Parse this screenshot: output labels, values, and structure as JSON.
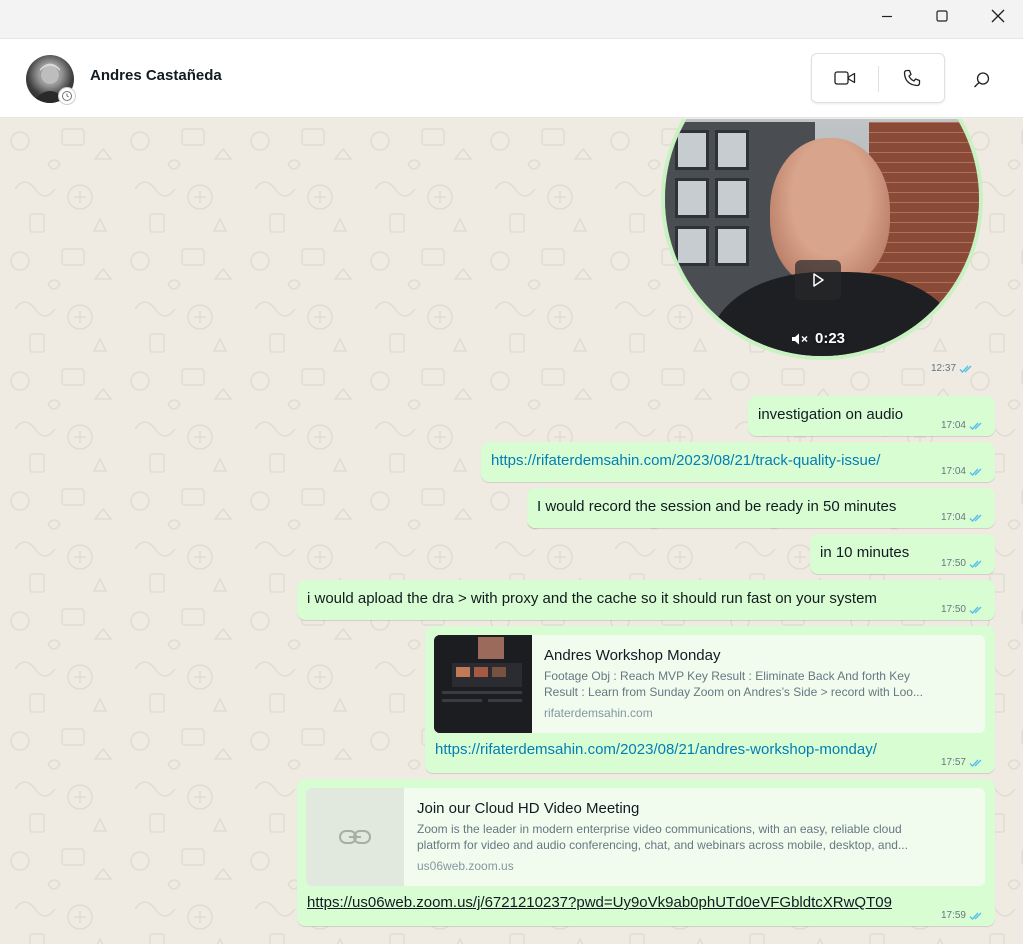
{
  "window": {
    "minimize_icon": "minimize-icon",
    "maximize_icon": "maximize-icon",
    "close_icon": "close-icon"
  },
  "header": {
    "contact_name": "Andres Castañeda",
    "avatar_icon": "avatar",
    "video_call_icon": "video-camera-icon",
    "voice_call_icon": "phone-icon",
    "search_icon": "search-icon"
  },
  "colors": {
    "outgoing_bubble": "#d9fdd3",
    "read_ticks": "#53bdeb",
    "link": "#027eb5",
    "chat_background": "#efeae2"
  },
  "messages": {
    "video_note": {
      "duration": "0:23",
      "time": "12:37",
      "muted_icon": "speaker-muted-icon",
      "play_icon": "play-icon"
    },
    "m1": {
      "text": "investigation on audio",
      "time": "17:04"
    },
    "m2": {
      "text": "https://rifaterdemsahin.com/2023/08/21/track-quality-issue/",
      "time": "17:04"
    },
    "m3": {
      "text": "I would record the session and be ready in 50 minutes",
      "time": "17:04"
    },
    "m4": {
      "text": "in 10 minutes",
      "time": "17:50"
    },
    "m5": {
      "text": "i would apload the dra > with proxy and the cache so it should run fast on your system",
      "time": "17:50"
    },
    "m6": {
      "preview_title": "Andres Workshop Monday",
      "preview_desc_line1": "Footage Obj : Reach MVP Key Result : Eliminate Back And forth Key",
      "preview_desc_line2": "Result : Learn from Sunday Zoom on Andres’s Side > record with Loo...",
      "preview_domain": "rifaterdemsahin.com",
      "text": "https://rifaterdemsahin.com/2023/08/21/andres-workshop-monday/",
      "time": "17:57"
    },
    "m7": {
      "preview_title": "Join our Cloud HD Video Meeting",
      "preview_desc_line1": "Zoom is the leader in modern enterprise video communications, with an easy, reliable cloud",
      "preview_desc_line2": "platform for video and audio conferencing, chat, and webinars across mobile, desktop, and...",
      "preview_domain": "us06web.zoom.us",
      "link_icon": "link-icon",
      "text": "https://us06web.zoom.us/j/6721210237?pwd=Uy9oVk9ab0phUTd0eVFGbldtcXRwQT09",
      "time": "17:59"
    }
  }
}
